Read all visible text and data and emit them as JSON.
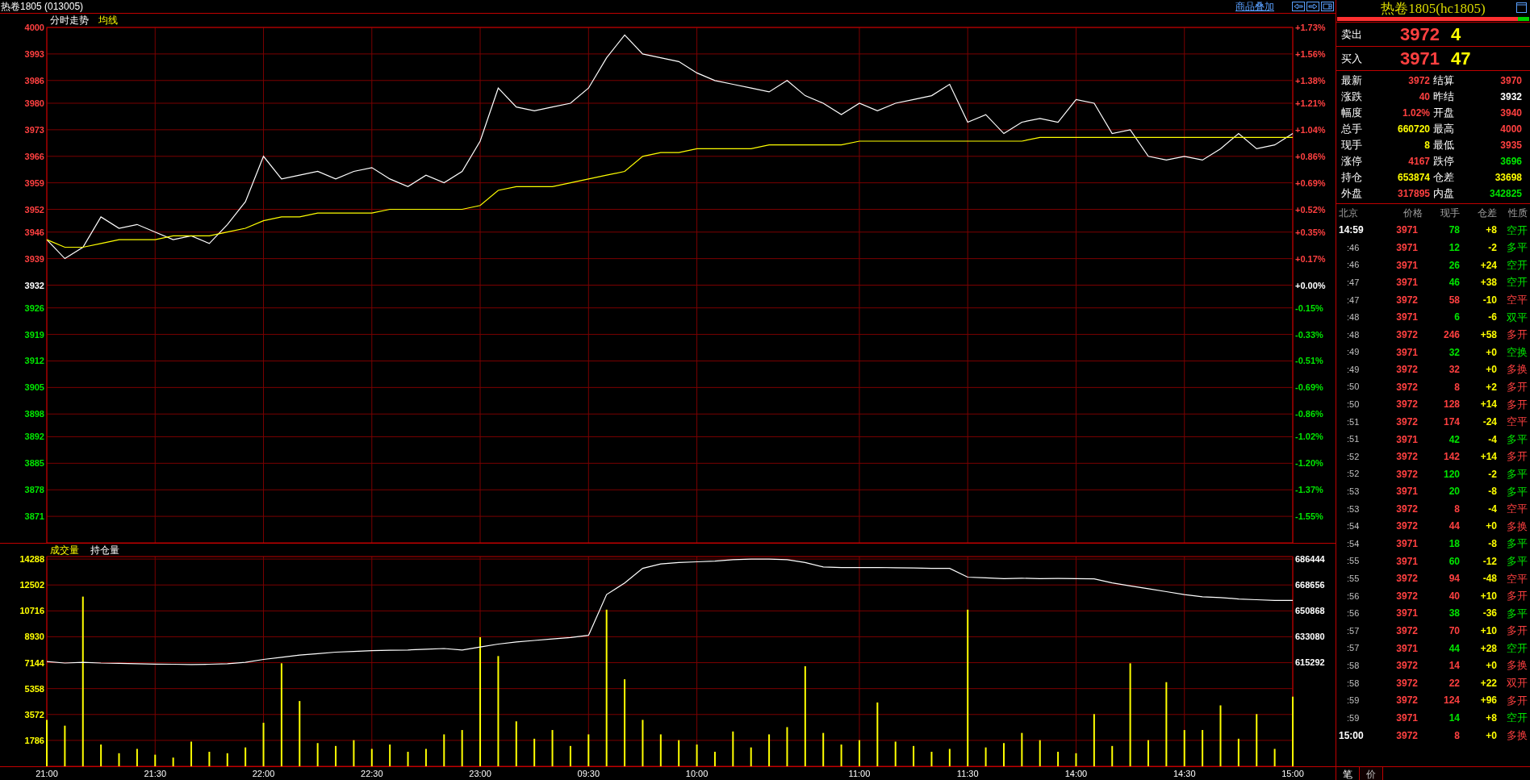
{
  "header": {
    "title": "热卷1805 (013005)",
    "overlay_link": "商品叠加"
  },
  "price_panel": {
    "axis_rows": [
      {
        "percent": "+1.73%",
        "color": "#ff4040"
      },
      {
        "percent": "+1.56%",
        "color": "#ff4040"
      },
      {
        "percent": "+1.38%",
        "color": "#ff4040"
      },
      {
        "percent": "+1.21%",
        "color": "#ff4040"
      },
      {
        "percent": "+1.04%",
        "color": "#ff4040"
      },
      {
        "percent": "+0.86%",
        "color": "#ff4040"
      },
      {
        "percent": "+0.69%",
        "color": "#ff4040"
      },
      {
        "percent": "+0.52%",
        "color": "#ff4040"
      },
      {
        "percent": "+0.35%",
        "color": "#ff4040"
      },
      {
        "percent": "+0.17%",
        "color": "#ff4040"
      },
      {
        "percent": "+0.00%",
        "color": "#ffffff"
      },
      {
        "percent": "-0.15%",
        "color": "#00e600"
      },
      {
        "percent": "-0.33%",
        "color": "#00e600"
      },
      {
        "percent": "-0.51%",
        "color": "#00e600"
      },
      {
        "percent": "-0.69%",
        "color": "#00e600"
      },
      {
        "percent": "-0.86%",
        "color": "#00e600"
      },
      {
        "percent": "-1.02%",
        "color": "#00e600"
      },
      {
        "percent": "-1.20%",
        "color": "#00e600"
      },
      {
        "percent": "-1.37%",
        "color": "#00e600"
      },
      {
        "percent": "-1.55%",
        "color": "#00e600"
      }
    ],
    "chart_data": {
      "type": "line",
      "grid": true,
      "ylim": [
        3864,
        4000
      ],
      "yticks": [
        4000,
        3993,
        3986,
        3980,
        3973,
        3966,
        3959,
        3952,
        3946,
        3939,
        3932,
        3926,
        3919,
        3912,
        3905,
        3898,
        3892,
        3885,
        3878,
        3871
      ],
      "series": [
        {
          "name": "分时走势",
          "color": "#ffffff",
          "values": [
            3944,
            3939,
            3942,
            3950,
            3947,
            3948,
            3946,
            3944,
            3945,
            3943,
            3948,
            3954,
            3966,
            3960,
            3961,
            3962,
            3960,
            3962,
            3963,
            3960,
            3958,
            3961,
            3959,
            3962,
            3970,
            3984,
            3979,
            3978,
            3979,
            3980,
            3984,
            3992,
            3998,
            3993,
            3992,
            3991,
            3988,
            3986,
            3985,
            3984,
            3983,
            3986,
            3982,
            3980,
            3977,
            3980,
            3978,
            3980,
            3981,
            3982,
            3985,
            3975,
            3977,
            3972,
            3975,
            3976,
            3975,
            3981,
            3980,
            3972,
            3973,
            3966,
            3965,
            3966,
            3965,
            3968,
            3972,
            3968,
            3969,
            3972
          ]
        },
        {
          "name": "均线",
          "color": "#ffff00",
          "values": [
            3944,
            3942,
            3942,
            3943,
            3944,
            3944,
            3944,
            3945,
            3945,
            3945,
            3946,
            3947,
            3949,
            3950,
            3950,
            3951,
            3951,
            3951,
            3951,
            3952,
            3952,
            3952,
            3952,
            3952,
            3953,
            3957,
            3958,
            3958,
            3958,
            3959,
            3960,
            3961,
            3962,
            3966,
            3967,
            3967,
            3968,
            3968,
            3968,
            3968,
            3969,
            3969,
            3969,
            3969,
            3969,
            3970,
            3970,
            3970,
            3970,
            3970,
            3970,
            3970,
            3970,
            3970,
            3970,
            3971,
            3971,
            3971,
            3971,
            3971,
            3971,
            3971,
            3971,
            3971,
            3971,
            3971,
            3971,
            3971,
            3971,
            3971
          ]
        }
      ]
    }
  },
  "volume_panel": {
    "chart_data": {
      "type": "bar",
      "grid": true,
      "ylim": [
        0,
        14460
      ],
      "categories": [
        "21:00",
        null,
        null,
        null,
        null,
        null,
        "21:30",
        null,
        null,
        null,
        null,
        null,
        "22:00",
        null,
        null,
        null,
        null,
        null,
        "22:30",
        null,
        null,
        null,
        null,
        null,
        "23:00",
        null,
        null,
        null,
        null,
        null,
        "09:30",
        null,
        null,
        null,
        null,
        null,
        "10:00",
        null,
        null,
        null,
        null,
        null,
        null,
        null,
        null,
        "11:00",
        null,
        null,
        null,
        null,
        null,
        "11:30",
        null,
        null,
        null,
        null,
        null,
        "14:00",
        null,
        null,
        null,
        null,
        null,
        "14:30",
        null,
        null,
        null,
        null,
        null,
        "15:00"
      ],
      "yticks": [
        {
          "value": 14288,
          "label": "14288"
        },
        {
          "value": 12502,
          "label": "12502"
        },
        {
          "value": 10716,
          "label": "10716"
        },
        {
          "value": 8930,
          "label": "8930"
        },
        {
          "value": 7144,
          "label": "7144"
        },
        {
          "value": 5358,
          "label": "5358"
        },
        {
          "value": 3572,
          "label": "3572"
        },
        {
          "value": 1786,
          "label": "1786"
        }
      ],
      "series": [
        {
          "name": "成交量",
          "color": "#ffff00",
          "values": [
            3200,
            2800,
            11700,
            1500,
            900,
            1200,
            800,
            600,
            1700,
            1000,
            900,
            1300,
            3000,
            7100,
            4500,
            1600,
            1400,
            1800,
            1200,
            1500,
            1000,
            1200,
            2200,
            2500,
            8900,
            7600,
            3100,
            1900,
            2500,
            1400,
            2200,
            10800,
            6000,
            3200,
            2200,
            1800,
            1500,
            1000,
            2400,
            1300,
            2200,
            2700,
            6900,
            2300,
            1500,
            1800,
            4400,
            1700,
            1400,
            1000,
            1200,
            10800,
            1300,
            1600,
            2300,
            1800,
            1000,
            900,
            3600,
            1400,
            7100,
            1800,
            5800,
            2500,
            2500,
            4200,
            1900,
            3600,
            1200,
            4800
          ]
        }
      ]
    },
    "open_interest_chart": {
      "chart_data": {
        "type": "line",
        "ylim": [
          544140,
          688100
        ],
        "yticks": [
          {
            "value": 686444,
            "label": "686444"
          },
          {
            "value": 668656,
            "label": "668656"
          },
          {
            "value": 650868,
            "label": "650868"
          },
          {
            "value": 633080,
            "label": "633080"
          },
          {
            "value": 615292,
            "label": "615292"
          }
        ],
        "series": [
          {
            "name": "持仓量",
            "color": "#ffffff",
            "values": [
              616000,
              615000,
              615500,
              615000,
              614800,
              614500,
              614300,
              614200,
              614000,
              614200,
              614500,
              615500,
              617500,
              619000,
              620500,
              621500,
              622500,
              623000,
              623500,
              623800,
              624000,
              624500,
              625000,
              624000,
              626000,
              628000,
              629500,
              630500,
              631500,
              632500,
              634000,
              662000,
              670000,
              680000,
              683000,
              684000,
              684500,
              685000,
              686000,
              686400,
              686400,
              686000,
              684000,
              681000,
              680500,
              680500,
              680600,
              680400,
              680300,
              680000,
              680000,
              674000,
              673500,
              673000,
              673200,
              673000,
              673100,
              673000,
              672800,
              670000,
              668000,
              666000,
              664000,
              662000,
              660500,
              660000,
              659000,
              658500,
              658000,
              658000
            ]
          }
        ]
      }
    }
  },
  "quote": {
    "title": "热卷1805(hc1805)",
    "ratio_bar": {
      "level": 0.94
    },
    "sell": {
      "label": "卖出",
      "price": "3972",
      "volume": "4"
    },
    "buy": {
      "label": "买入",
      "price": "3971",
      "volume": "47"
    },
    "stats": [
      {
        "label": "最新",
        "value": "3972",
        "color": "#ff4040"
      },
      {
        "label": "结算",
        "value": "3970",
        "color": "#ff4040"
      },
      {
        "label": "涨跌",
        "value": "40",
        "color": "#ff4040"
      },
      {
        "label": "昨结",
        "value": "3932",
        "color": "#ffffff"
      },
      {
        "label": "幅度",
        "value": "1.02%",
        "color": "#ff4040"
      },
      {
        "label": "开盘",
        "value": "3940",
        "color": "#ff4040"
      },
      {
        "label": "总手",
        "value": "660720",
        "color": "#ffff00"
      },
      {
        "label": "最高",
        "value": "4000",
        "color": "#ff4040"
      },
      {
        "label": "现手",
        "value": "8",
        "color": "#ffff00"
      },
      {
        "label": "最低",
        "value": "3935",
        "color": "#ff4040"
      },
      {
        "label": "涨停",
        "value": "4167",
        "color": "#ff4040"
      },
      {
        "label": "跌停",
        "value": "3696",
        "color": "#00e600"
      },
      {
        "label": "持仓",
        "value": "653874",
        "color": "#ffff00"
      },
      {
        "label": "仓差",
        "value": "33698",
        "color": "#ffff00"
      },
      {
        "label": "外盘",
        "value": "317895",
        "color": "#ff4040"
      },
      {
        "label": "内盘",
        "value": "342825",
        "color": "#00e600"
      }
    ]
  },
  "trades": {
    "columns": [
      "北京",
      "价格",
      "现手",
      "仓差",
      "性质"
    ],
    "rows": [
      {
        "time": "14:59",
        "price": "3971",
        "volume": "78",
        "change": "+8",
        "nature": "空开",
        "active_buy": false,
        "emphasis": true
      },
      {
        "time": ":46",
        "price": "3971",
        "volume": "12",
        "change": "-2",
        "nature": "多平",
        "active_buy": false,
        "emphasis": false
      },
      {
        "time": ":46",
        "price": "3971",
        "volume": "26",
        "change": "+24",
        "nature": "空开",
        "active_buy": false,
        "emphasis": false
      },
      {
        "time": ":47",
        "price": "3971",
        "volume": "46",
        "change": "+38",
        "nature": "空开",
        "active_buy": false,
        "emphasis": false
      },
      {
        "time": ":47",
        "price": "3972",
        "volume": "58",
        "change": "-10",
        "nature": "空平",
        "active_buy": true,
        "emphasis": false
      },
      {
        "time": ":48",
        "price": "3971",
        "volume": "6",
        "change": "-6",
        "nature": "双平",
        "active_buy": false,
        "emphasis": false
      },
      {
        "time": ":48",
        "price": "3972",
        "volume": "246",
        "change": "+58",
        "nature": "多开",
        "active_buy": true,
        "emphasis": false
      },
      {
        "time": ":49",
        "price": "3971",
        "volume": "32",
        "change": "+0",
        "nature": "空换",
        "active_buy": false,
        "emphasis": false
      },
      {
        "time": ":49",
        "price": "3972",
        "volume": "32",
        "change": "+0",
        "nature": "多换",
        "active_buy": true,
        "emphasis": false
      },
      {
        "time": ":50",
        "price": "3972",
        "volume": "8",
        "change": "+2",
        "nature": "多开",
        "active_buy": true,
        "emphasis": false
      },
      {
        "time": ":50",
        "price": "3972",
        "volume": "128",
        "change": "+14",
        "nature": "多开",
        "active_buy": true,
        "emphasis": false
      },
      {
        "time": ":51",
        "price": "3972",
        "volume": "174",
        "change": "-24",
        "nature": "空平",
        "active_buy": true,
        "emphasis": false
      },
      {
        "time": ":51",
        "price": "3971",
        "volume": "42",
        "change": "-4",
        "nature": "多平",
        "active_buy": false,
        "emphasis": false
      },
      {
        "time": ":52",
        "price": "3972",
        "volume": "142",
        "change": "+14",
        "nature": "多开",
        "active_buy": true,
        "emphasis": false
      },
      {
        "time": ":52",
        "price": "3972",
        "volume": "120",
        "change": "-2",
        "nature": "多平",
        "active_buy": false,
        "emphasis": false
      },
      {
        "time": ":53",
        "price": "3971",
        "volume": "20",
        "change": "-8",
        "nature": "多平",
        "active_buy": false,
        "emphasis": false
      },
      {
        "time": ":53",
        "price": "3972",
        "volume": "8",
        "change": "-4",
        "nature": "空平",
        "active_buy": true,
        "emphasis": false
      },
      {
        "time": ":54",
        "price": "3972",
        "volume": "44",
        "change": "+0",
        "nature": "多换",
        "active_buy": true,
        "emphasis": false
      },
      {
        "time": ":54",
        "price": "3971",
        "volume": "18",
        "change": "-8",
        "nature": "多平",
        "active_buy": false,
        "emphasis": false
      },
      {
        "time": ":55",
        "price": "3971",
        "volume": "60",
        "change": "-12",
        "nature": "多平",
        "active_buy": false,
        "emphasis": false
      },
      {
        "time": ":55",
        "price": "3972",
        "volume": "94",
        "change": "-48",
        "nature": "空平",
        "active_buy": true,
        "emphasis": false
      },
      {
        "time": ":56",
        "price": "3972",
        "volume": "40",
        "change": "+10",
        "nature": "多开",
        "active_buy": true,
        "emphasis": false
      },
      {
        "time": ":56",
        "price": "3971",
        "volume": "38",
        "change": "-36",
        "nature": "多平",
        "active_buy": false,
        "emphasis": false
      },
      {
        "time": ":57",
        "price": "3972",
        "volume": "70",
        "change": "+10",
        "nature": "多开",
        "active_buy": true,
        "emphasis": false
      },
      {
        "time": ":57",
        "price": "3971",
        "volume": "44",
        "change": "+28",
        "nature": "空开",
        "active_buy": false,
        "emphasis": false
      },
      {
        "time": ":58",
        "price": "3972",
        "volume": "14",
        "change": "+0",
        "nature": "多换",
        "active_buy": true,
        "emphasis": false
      },
      {
        "time": ":58",
        "price": "3972",
        "volume": "22",
        "change": "+22",
        "nature": "双开",
        "active_buy": true,
        "emphasis": false
      },
      {
        "time": ":59",
        "price": "3972",
        "volume": "124",
        "change": "+96",
        "nature": "多开",
        "active_buy": true,
        "emphasis": false
      },
      {
        "time": ":59",
        "price": "3971",
        "volume": "14",
        "change": "+8",
        "nature": "空开",
        "active_buy": false,
        "emphasis": false
      },
      {
        "time": "15:00",
        "price": "3972",
        "volume": "8",
        "change": "+0",
        "nature": "多换",
        "active_buy": true,
        "emphasis": true
      }
    ]
  },
  "bottom_tabs": [
    {
      "label": "笔",
      "selected": true
    },
    {
      "label": "价",
      "selected": false
    }
  ]
}
